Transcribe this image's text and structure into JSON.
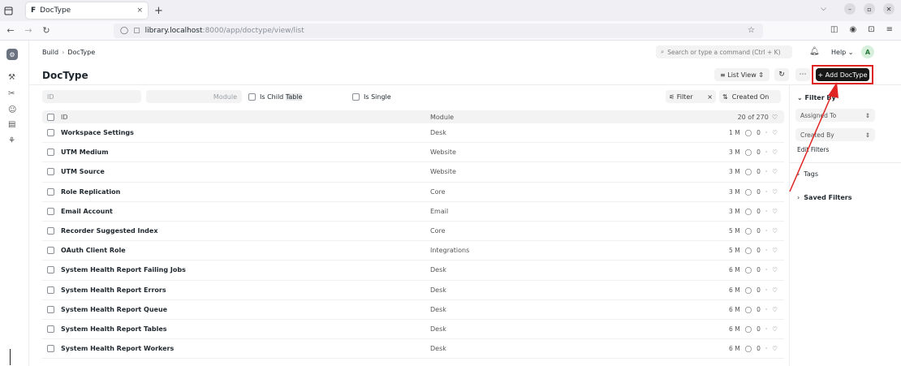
{
  "browser": {
    "tab_favicon": "F",
    "tab_title": "DocType",
    "tab_close": "×",
    "new_tab": "+",
    "url_host": "library.localhost",
    "url_rest": ":8000/app/doctype/view/list"
  },
  "app": {
    "breadcrumb": [
      "Build",
      "DocType"
    ],
    "breadcrumb_sep": "›",
    "search_placeholder": "Search or type a command (Ctrl + K)",
    "help_label": "Help",
    "avatar_initial": "A",
    "page_title": "DocType",
    "list_view_label": "List View",
    "add_label": "+ Add DocType"
  },
  "filters": {
    "id_placeholder": "ID",
    "module_placeholder": "Module",
    "is_child_table_prefix": "Is Child ",
    "is_child_table_highlight": "Table",
    "is_single": "Is Single",
    "filter_label": "Filter",
    "filter_clear": "×",
    "sort_label": "Created On"
  },
  "table": {
    "col_id": "ID",
    "col_module": "Module",
    "count": "20 of 270",
    "rows": [
      {
        "name": "Workspace Settings",
        "module": "Desk",
        "age": "1 M",
        "comments": "0"
      },
      {
        "name": "UTM Medium",
        "module": "Website",
        "age": "3 M",
        "comments": "0"
      },
      {
        "name": "UTM Source",
        "module": "Website",
        "age": "3 M",
        "comments": "0"
      },
      {
        "name": "Role Replication",
        "module": "Core",
        "age": "3 M",
        "comments": "0"
      },
      {
        "name": "Email Account",
        "module": "Email",
        "age": "3 M",
        "comments": "0"
      },
      {
        "name": "Recorder Suggested Index",
        "module": "Core",
        "age": "5 M",
        "comments": "0"
      },
      {
        "name": "OAuth Client Role",
        "module": "Integrations",
        "age": "5 M",
        "comments": "0"
      },
      {
        "name": "System Health Report Failing Jobs",
        "module": "Desk",
        "age": "6 M",
        "comments": "0"
      },
      {
        "name": "System Health Report Errors",
        "module": "Desk",
        "age": "6 M",
        "comments": "0"
      },
      {
        "name": "System Health Report Queue",
        "module": "Desk",
        "age": "6 M",
        "comments": "0"
      },
      {
        "name": "System Health Report Tables",
        "module": "Desk",
        "age": "6 M",
        "comments": "0"
      },
      {
        "name": "System Health Report Workers",
        "module": "Desk",
        "age": "6 M",
        "comments": "0"
      }
    ]
  },
  "sidebar": {
    "filter_by": "Filter By",
    "assigned_to": "Assigned To",
    "created_by": "Created By",
    "edit_filters": "Edit Filters",
    "tags": "Tags",
    "saved_filters": "Saved Filters"
  },
  "colors": {
    "primary_button": "#171717",
    "highlight_box": "#e02424"
  }
}
